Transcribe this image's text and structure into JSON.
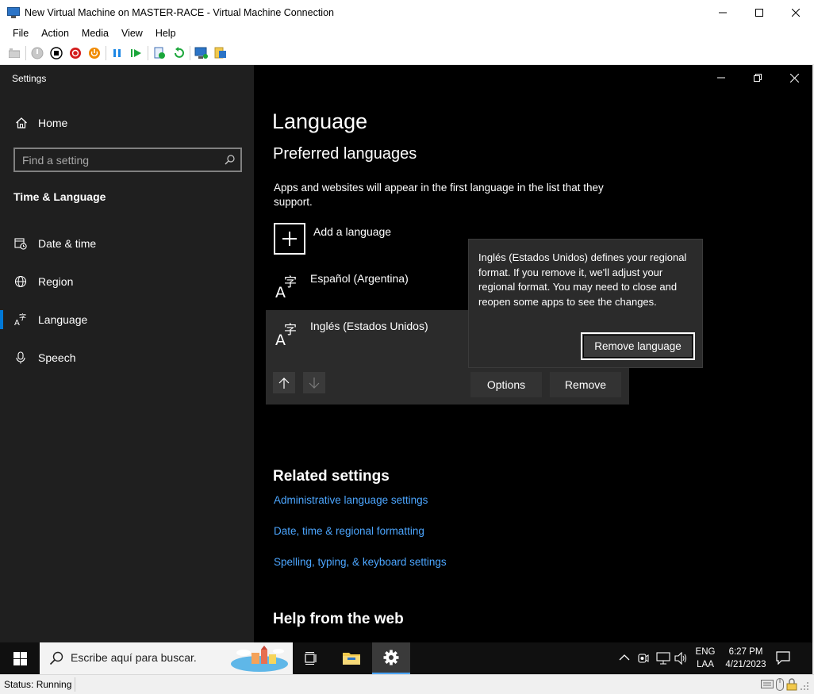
{
  "host": {
    "title": "New Virtual Machine on MASTER-RACE - Virtual Machine Connection",
    "menu": [
      "File",
      "Action",
      "Media",
      "View",
      "Help"
    ],
    "status": "Status: Running"
  },
  "settings": {
    "window_title": "Settings",
    "home_label": "Home",
    "search_placeholder": "Find a setting",
    "section_title": "Time & Language",
    "nav": [
      {
        "label": "Date & time",
        "icon": "calendar-clock-icon"
      },
      {
        "label": "Region",
        "icon": "globe-icon"
      },
      {
        "label": "Language",
        "icon": "language-icon"
      },
      {
        "label": "Speech",
        "icon": "microphone-icon"
      }
    ],
    "selected_nav": "Language"
  },
  "language_page": {
    "title": "Language",
    "preferred_heading": "Preferred languages",
    "description": "Apps and websites will appear in the first language in the list that they support.",
    "add_language_label": "Add a language",
    "languages": [
      {
        "name": "Español (Argentina)"
      },
      {
        "name": "Inglés (Estados Unidos)"
      }
    ],
    "options_label": "Options",
    "remove_label": "Remove",
    "tooltip": {
      "text": "Inglés (Estados Unidos) defines your regional format. If you remove it, we'll adjust your regional format. You may need to close and reopen some apps to see the changes.",
      "button_label": "Remove language"
    },
    "related_heading": "Related settings",
    "related_links": [
      "Administrative language settings",
      "Date, time & regional formatting",
      "Spelling, typing, & keyboard settings"
    ],
    "help_heading": "Help from the web"
  },
  "taskbar": {
    "search_placeholder": "Escribe aquí para buscar.",
    "lang_top": "ENG",
    "lang_bottom": "LAA",
    "time": "6:27 PM",
    "date": "4/21/2023"
  },
  "colors": {
    "accent": "#0078d7",
    "link": "#4ca6ff",
    "sidebar_bg": "#1f1f1f",
    "content_bg": "#000000"
  }
}
